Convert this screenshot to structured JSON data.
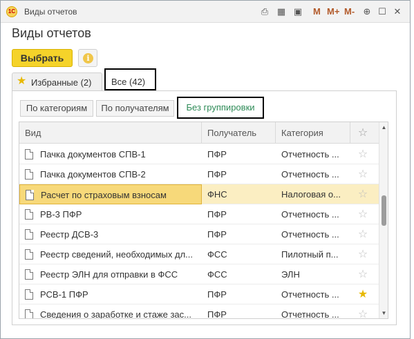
{
  "window": {
    "title": "Виды отчетов",
    "toolbar_m": [
      "M",
      "M+",
      "M-"
    ]
  },
  "page_title": "Виды отчетов",
  "buttons": {
    "choose": "Выбрать",
    "info_glyph": "i"
  },
  "tabs": [
    {
      "label": "Избранные (2)"
    },
    {
      "label": "Все (42)"
    }
  ],
  "grouping": [
    "По категориям",
    "По получателям",
    "Без группировки"
  ],
  "columns": [
    "Вид",
    "Получатель",
    "Категория"
  ],
  "rows": [
    {
      "name": "Пачка документов СПВ-1",
      "recipient": "ПФР",
      "category": "Отчетность ...",
      "fav": false
    },
    {
      "name": "Пачка документов СПВ-2",
      "recipient": "ПФР",
      "category": "Отчетность ...",
      "fav": false
    },
    {
      "name": "Расчет по страховым взносам",
      "recipient": "ФНС",
      "category": "Налоговая о...",
      "fav": false,
      "selected": true
    },
    {
      "name": "РВ-3 ПФР",
      "recipient": "ПФР",
      "category": "Отчетность ...",
      "fav": false
    },
    {
      "name": "Реестр ДСВ-3",
      "recipient": "ПФР",
      "category": "Отчетность ...",
      "fav": false
    },
    {
      "name": "Реестр сведений, необходимых дл...",
      "recipient": "ФСС",
      "category": "Пилотный п...",
      "fav": false
    },
    {
      "name": "Реестр ЭЛН для отправки в ФСС",
      "recipient": "ФСС",
      "category": "ЭЛН",
      "fav": false
    },
    {
      "name": "РСВ-1 ПФР",
      "recipient": "ПФР",
      "category": "Отчетность ...",
      "fav": true
    },
    {
      "name": "Сведения о заработке и стаже зас...",
      "recipient": "ПФР",
      "category": "Отчетность ...",
      "fav": false
    }
  ],
  "colors": {
    "accent_yellow": "#f5d32a",
    "selected_row": "#fbeec2",
    "active_seg_text": "#2e8b57",
    "star_on": "#e7b800"
  }
}
